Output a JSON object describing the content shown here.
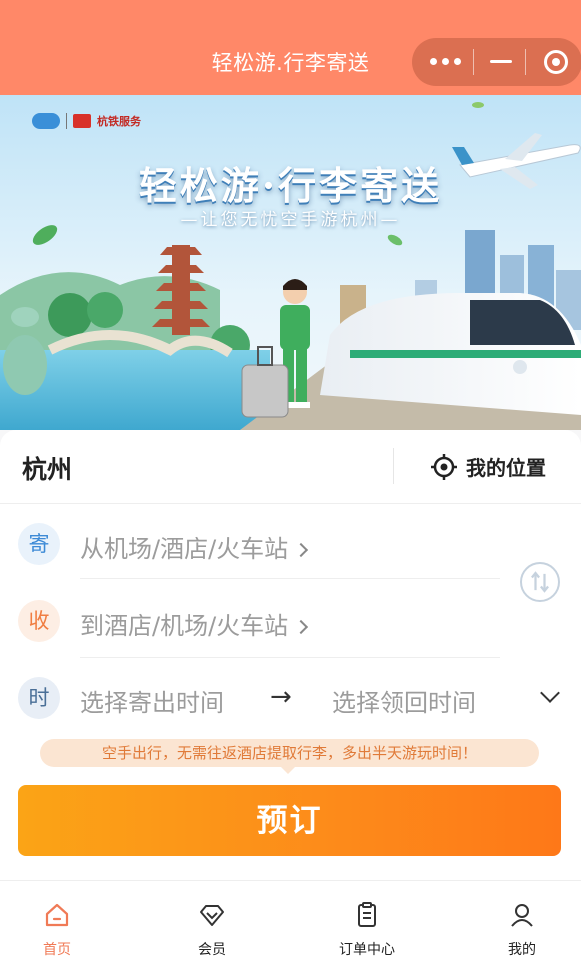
{
  "header": {
    "title": "轻松游.行李寄送"
  },
  "banner": {
    "title": "轻松游·行李寄送",
    "subtitle": "—让您无忧空手游杭州—",
    "logo_text": "杭铁服务"
  },
  "location": {
    "city": "杭州",
    "my_location_label": "我的位置"
  },
  "send": {
    "badge": "寄",
    "placeholder": "从机场/酒店/火车站"
  },
  "receive": {
    "badge": "收",
    "placeholder": "到酒店/机场/火车站"
  },
  "time": {
    "badge": "时",
    "from_placeholder": "选择寄出时间",
    "arrow": "→",
    "to_placeholder": "选择领回时间"
  },
  "tip": "空手出行，无需往返酒店提取行李，多出半天游玩时间！",
  "book_button": "预订",
  "tabs": [
    {
      "label": "首页",
      "icon": "home-icon",
      "active": true
    },
    {
      "label": "会员",
      "icon": "diamond-icon",
      "active": false
    },
    {
      "label": "订单中心",
      "icon": "clipboard-icon",
      "active": false
    },
    {
      "label": "我的",
      "icon": "user-icon",
      "active": false
    }
  ],
  "colors": {
    "header": "#ff8868",
    "accent": "#f07a56",
    "button_start": "#fba416",
    "button_end": "#fe7818"
  }
}
